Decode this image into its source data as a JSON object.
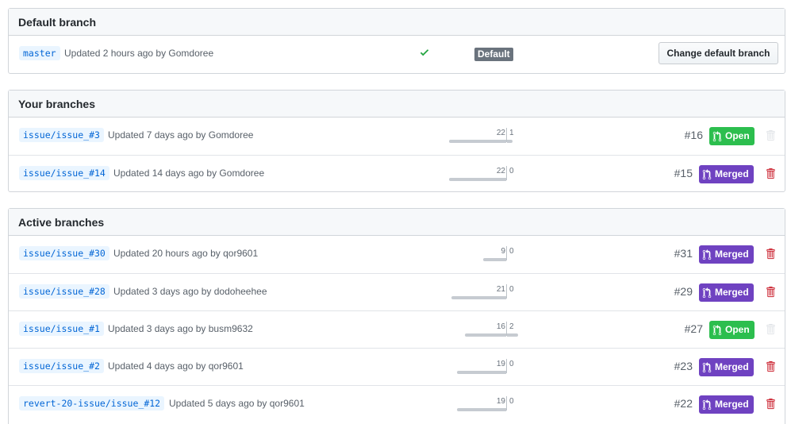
{
  "colors": {
    "open": "#2cbe4e",
    "merged": "#6f42c1",
    "trash_active": "#cb2431",
    "trash_disabled": "#e1e4e8",
    "check": "#28a745",
    "link": "#0366d6"
  },
  "default_section": {
    "title": "Default branch",
    "branch": {
      "name": "master",
      "updated": "Updated 2 hours ago by Gomdoree",
      "label": "Default",
      "change_button": "Change default branch"
    }
  },
  "your_section": {
    "title": "Your branches",
    "branches": [
      {
        "name": "issue/issue_#3",
        "updated": "Updated 7 days ago by Gomdoree",
        "behind": "22",
        "ahead": "1",
        "pr_number": "#16",
        "pr_state": "Open",
        "trash_enabled": false
      },
      {
        "name": "issue/issue_#14",
        "updated": "Updated 14 days ago by Gomdoree",
        "behind": "22",
        "ahead": "0",
        "pr_number": "#15",
        "pr_state": "Merged",
        "trash_enabled": true
      }
    ]
  },
  "active_section": {
    "title": "Active branches",
    "branches": [
      {
        "name": "issue/issue_#30",
        "updated": "Updated 20 hours ago by qor9601",
        "behind": "9",
        "ahead": "0",
        "pr_number": "#31",
        "pr_state": "Merged",
        "trash_enabled": true
      },
      {
        "name": "issue/issue_#28",
        "updated": "Updated 3 days ago by dodoheehee",
        "behind": "21",
        "ahead": "0",
        "pr_number": "#29",
        "pr_state": "Merged",
        "trash_enabled": true
      },
      {
        "name": "issue/issue_#1",
        "updated": "Updated 3 days ago by busm9632",
        "behind": "16",
        "ahead": "2",
        "pr_number": "#27",
        "pr_state": "Open",
        "trash_enabled": false
      },
      {
        "name": "issue/issue_#2",
        "updated": "Updated 4 days ago by qor9601",
        "behind": "19",
        "ahead": "0",
        "pr_number": "#23",
        "pr_state": "Merged",
        "trash_enabled": true
      },
      {
        "name": "revert-20-issue/issue_#12",
        "updated": "Updated 5 days ago by qor9601",
        "behind": "19",
        "ahead": "0",
        "pr_number": "#22",
        "pr_state": "Merged",
        "trash_enabled": true
      }
    ]
  }
}
